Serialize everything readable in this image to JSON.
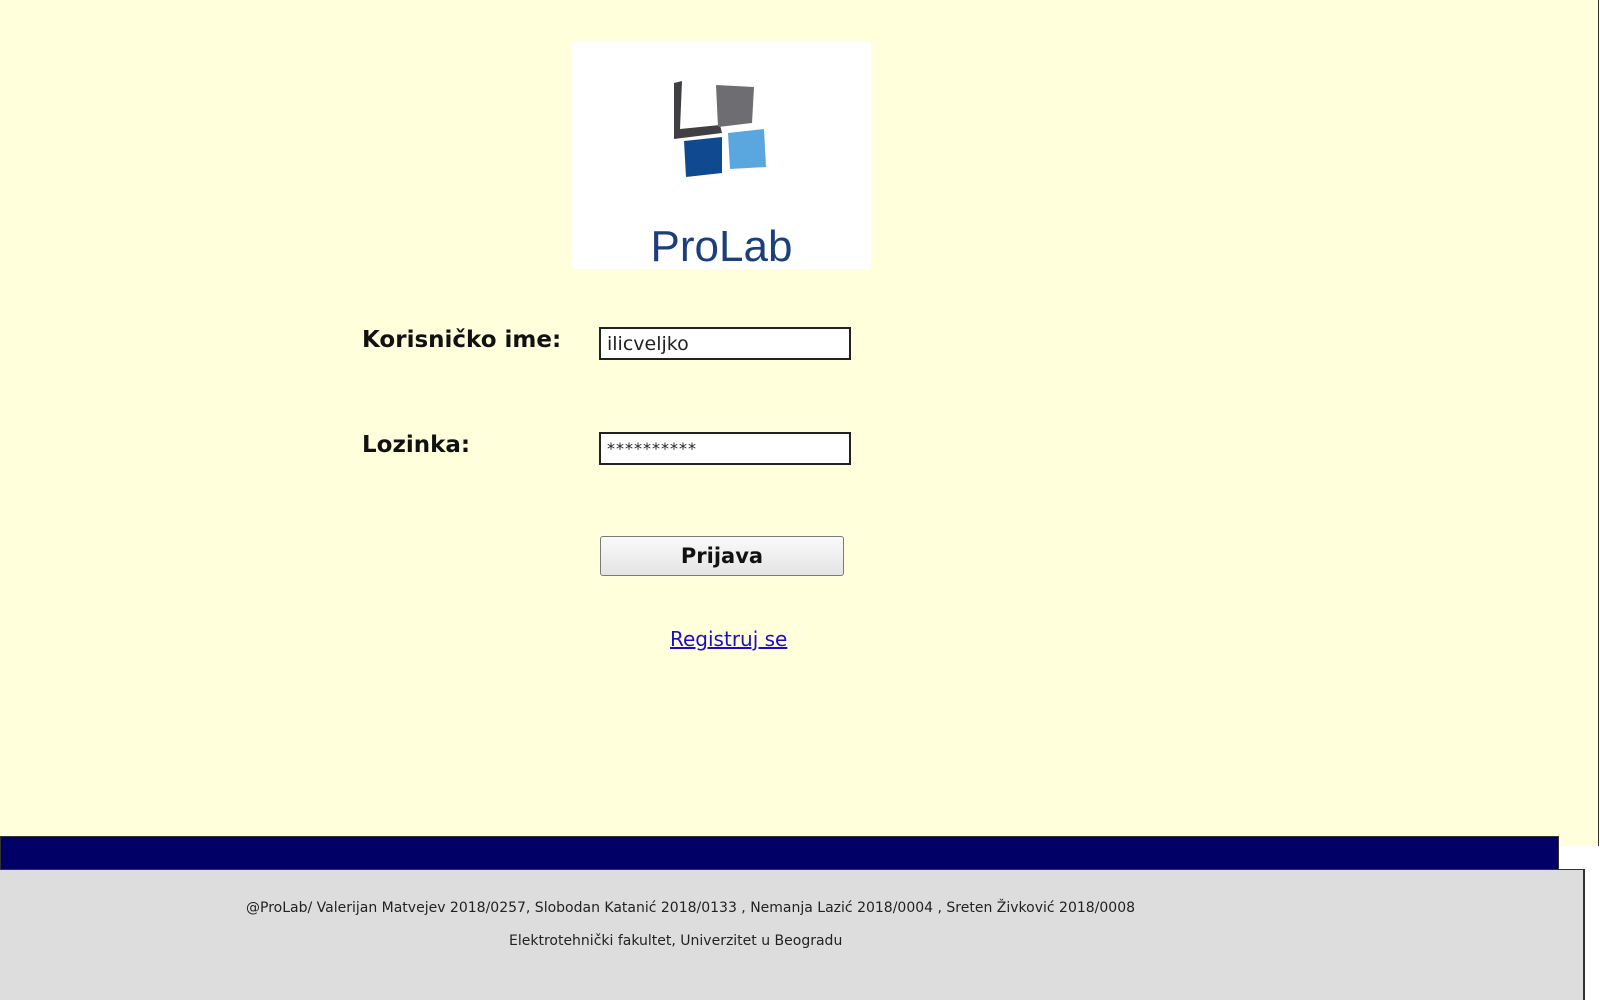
{
  "logo": {
    "wordmark": "ProLab",
    "colors": {
      "dark_gray": "#3f3f44",
      "gray": "#6d6d72",
      "navy": "#0f4a90",
      "light_blue": "#5aa6de",
      "wordmark": "#1c3f7a"
    }
  },
  "login_form": {
    "username_label": "Korisničko ime:",
    "username_value": "ilicveljko",
    "password_label": "Lozinka:",
    "password_value": "**********",
    "submit_label": "Prijava",
    "register_link": "Registruj se"
  },
  "footer": {
    "line1": "@ProLab/ Valerijan Matvejev 2018/0257, Slobodan Katanić 2018/0133 , Nemanja Lazić 2018/0004 , Sreten Živković 2018/0008",
    "line2": "Elektrotehnički fakultet, Univerzitet u Beogradu"
  },
  "colors": {
    "page_background": "#ffffdc",
    "footer_stripe": "#000066",
    "footer_background": "#dddddd",
    "link": "#1a0dcc"
  }
}
